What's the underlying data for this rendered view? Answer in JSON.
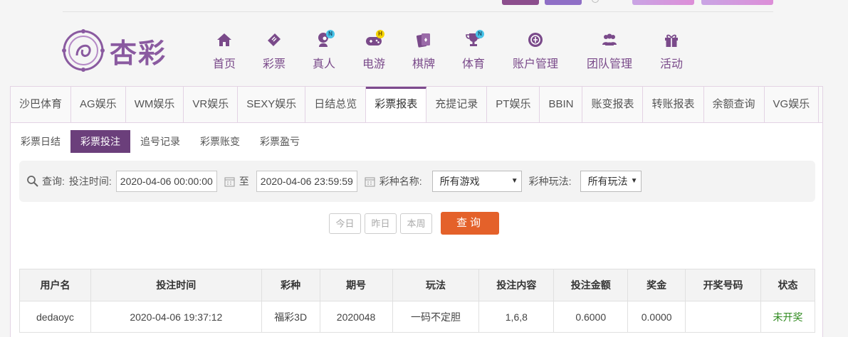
{
  "logo": {
    "text": "杏彩"
  },
  "nav": [
    {
      "label": "首页",
      "icon": "home-icon",
      "badge": ""
    },
    {
      "label": "彩票",
      "icon": "lottery-ticket-icon",
      "badge": ""
    },
    {
      "label": "真人",
      "icon": "live-dealer-icon",
      "badge": "N"
    },
    {
      "label": "电游",
      "icon": "gamepad-icon",
      "badge": "H"
    },
    {
      "label": "棋牌",
      "icon": "cards-icon",
      "badge": ""
    },
    {
      "label": "体育",
      "icon": "trophy-icon",
      "badge": "N"
    },
    {
      "label": "账户管理",
      "icon": "account-icon",
      "badge": ""
    },
    {
      "label": "团队管理",
      "icon": "team-icon",
      "badge": ""
    },
    {
      "label": "活动",
      "icon": "gift-icon",
      "badge": ""
    }
  ],
  "tabs": [
    "沙巴体育",
    "AG娱乐",
    "WM娱乐",
    "VR娱乐",
    "SEXY娱乐",
    "日结总览",
    "彩票报表",
    "充提记录",
    "PT娱乐",
    "BBIN",
    "账变报表",
    "转账报表",
    "余额查询",
    "VG娱乐"
  ],
  "subtabs": [
    "彩票日结",
    "彩票投注",
    "追号记录",
    "彩票账变",
    "彩票盈亏"
  ],
  "filter": {
    "query_label": "查询:",
    "time_label": "投注时间:",
    "start": "2020-04-06 00:00:00",
    "to": "至",
    "end": "2020-04-06 23:59:59",
    "game_label": "彩种名称:",
    "game_value": "所有游戏",
    "play_label": "彩种玩法:",
    "play_value": "所有玩法"
  },
  "quick": {
    "today": "今日",
    "yesterday": "昨日",
    "week": "本周"
  },
  "search_button": "查询",
  "table": {
    "headers": [
      "用户名",
      "投注时间",
      "彩种",
      "期号",
      "玩法",
      "投注内容",
      "投注金额",
      "奖金",
      "开奖号码",
      "状态"
    ],
    "rows": [
      [
        "dedaoyc",
        "2020-04-06 19:37:12",
        "福彩3D",
        "2020048",
        "一码不定胆",
        "1,6,8",
        "0.6000",
        "0.0000",
        "",
        "未开奖"
      ]
    ]
  },
  "colors": {
    "brand": "#7c4a8d",
    "accent": "#e4612a",
    "status_pending": "#2f8a1f"
  }
}
